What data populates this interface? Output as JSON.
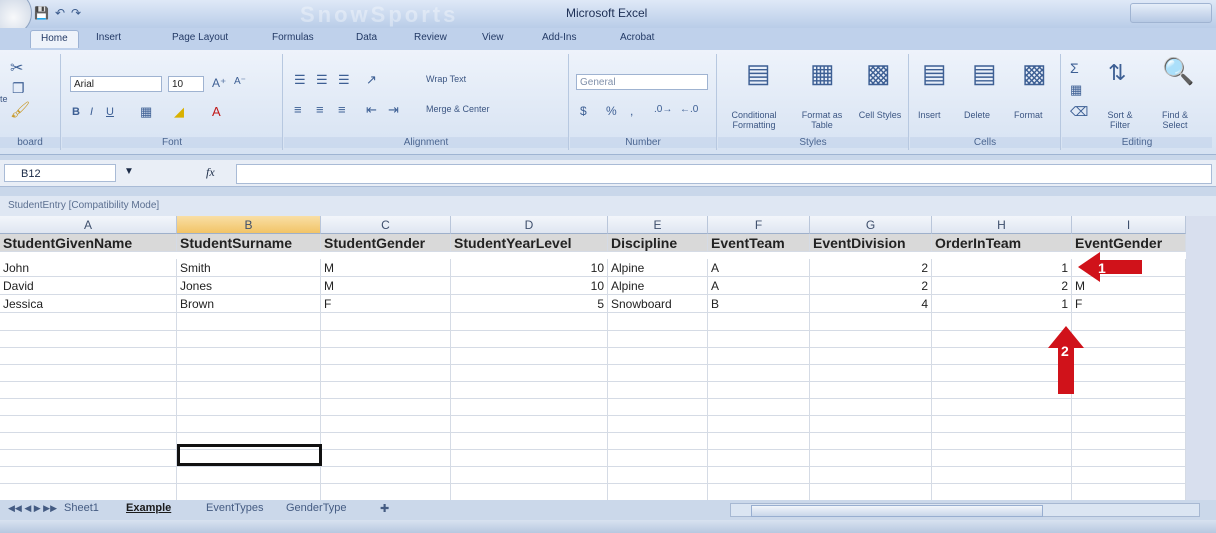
{
  "window": {
    "title": "Microsoft Excel",
    "title_deco": "SnowSports"
  },
  "ribbon_tabs": [
    "Home",
    "Insert",
    "Page Layout",
    "Formulas",
    "Data",
    "Review",
    "View",
    "Add-Ins",
    "Acrobat"
  ],
  "ribbon": {
    "clipboard": {
      "label": "board",
      "paste": "te"
    },
    "font": {
      "label": "Font",
      "name": "Arial",
      "size": "10"
    },
    "alignment": {
      "label": "Alignment",
      "wrap_text": "Wrap Text",
      "merge_center": "Merge & Center"
    },
    "number": {
      "label": "Number",
      "format": "General",
      "currency": "$",
      "percent": "%"
    },
    "styles": {
      "label": "Styles",
      "conditional": "Conditional Formatting",
      "format_table": "Format as Table",
      "cell_styles": "Cell Styles"
    },
    "cells": {
      "label": "Cells",
      "insert": "Insert",
      "delete": "Delete",
      "format": "Format"
    },
    "editing": {
      "label": "Editing",
      "sort_filter": "Sort & Filter",
      "find_select": "Find & Select"
    }
  },
  "formula_bar": {
    "name_box": "B12",
    "fx": "fx",
    "value": ""
  },
  "document_title": "StudentEntry [Compatibility Mode]",
  "columns": [
    "A",
    "B",
    "C",
    "D",
    "E",
    "F",
    "G",
    "H",
    "I"
  ],
  "header_row": [
    "StudentGivenName",
    "StudentSurname",
    "StudentGender",
    "StudentYearLevel",
    "Discipline",
    "EventTeam",
    "EventDivision",
    "OrderInTeam",
    "EventGender"
  ],
  "rows": [
    [
      "John",
      "Smith",
      "M",
      "10",
      "Alpine",
      "A",
      "2",
      "1",
      ""
    ],
    [
      "David",
      "Jones",
      "M",
      "10",
      "Alpine",
      "A",
      "2",
      "2",
      "M"
    ],
    [
      "Jessica",
      "Brown",
      "F",
      "5",
      "Snowboard",
      "B",
      "4",
      "1",
      "F"
    ]
  ],
  "annotations": [
    {
      "label": "1",
      "color": "#d0121a"
    },
    {
      "label": "2",
      "color": "#d0121a"
    }
  ],
  "sheet_tabs": [
    "Sheet1",
    "Example",
    "EventTypes",
    "GenderType"
  ],
  "active_sheet": "Example",
  "selected_cell": "B12"
}
